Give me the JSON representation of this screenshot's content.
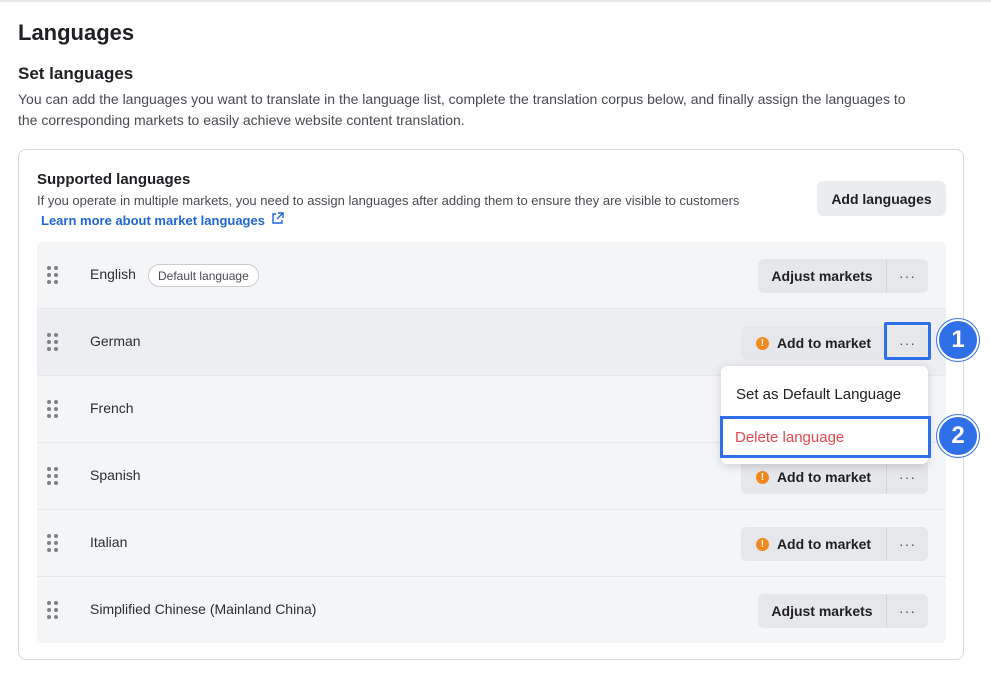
{
  "page": {
    "title": "Languages",
    "section_title": "Set languages",
    "section_desc": "You can add the languages you want to translate in the language list, complete the translation corpus below, and finally assign the languages to the corresponding markets to easily achieve website content translation."
  },
  "card": {
    "title": "Supported languages",
    "desc": "If you operate in multiple markets, you need to assign languages after adding them to ensure they are visible to customers",
    "learn_more": "Learn more about market languages",
    "add_button": "Add languages"
  },
  "languages": [
    {
      "name": "English",
      "badge": "Default language",
      "action": "Adjust markets",
      "warning": false
    },
    {
      "name": "German",
      "badge": "",
      "action": "Add to market",
      "warning": true
    },
    {
      "name": "French",
      "badge": "",
      "action": "",
      "warning": false
    },
    {
      "name": "Spanish",
      "badge": "",
      "action": "Add to market",
      "warning": true
    },
    {
      "name": "Italian",
      "badge": "",
      "action": "Add to market",
      "warning": true
    },
    {
      "name": "Simplified Chinese (Mainland China)",
      "badge": "",
      "action": "Adjust markets",
      "warning": false
    }
  ],
  "more_label": "···",
  "dropdown": {
    "items": [
      "Set as Default Language",
      "Delete language"
    ]
  },
  "markers": [
    "1",
    "2"
  ],
  "colors": {
    "accent": "#2f6fe8",
    "link": "#1f65d6",
    "danger": "#e5484d",
    "warning": "#f2891f"
  }
}
